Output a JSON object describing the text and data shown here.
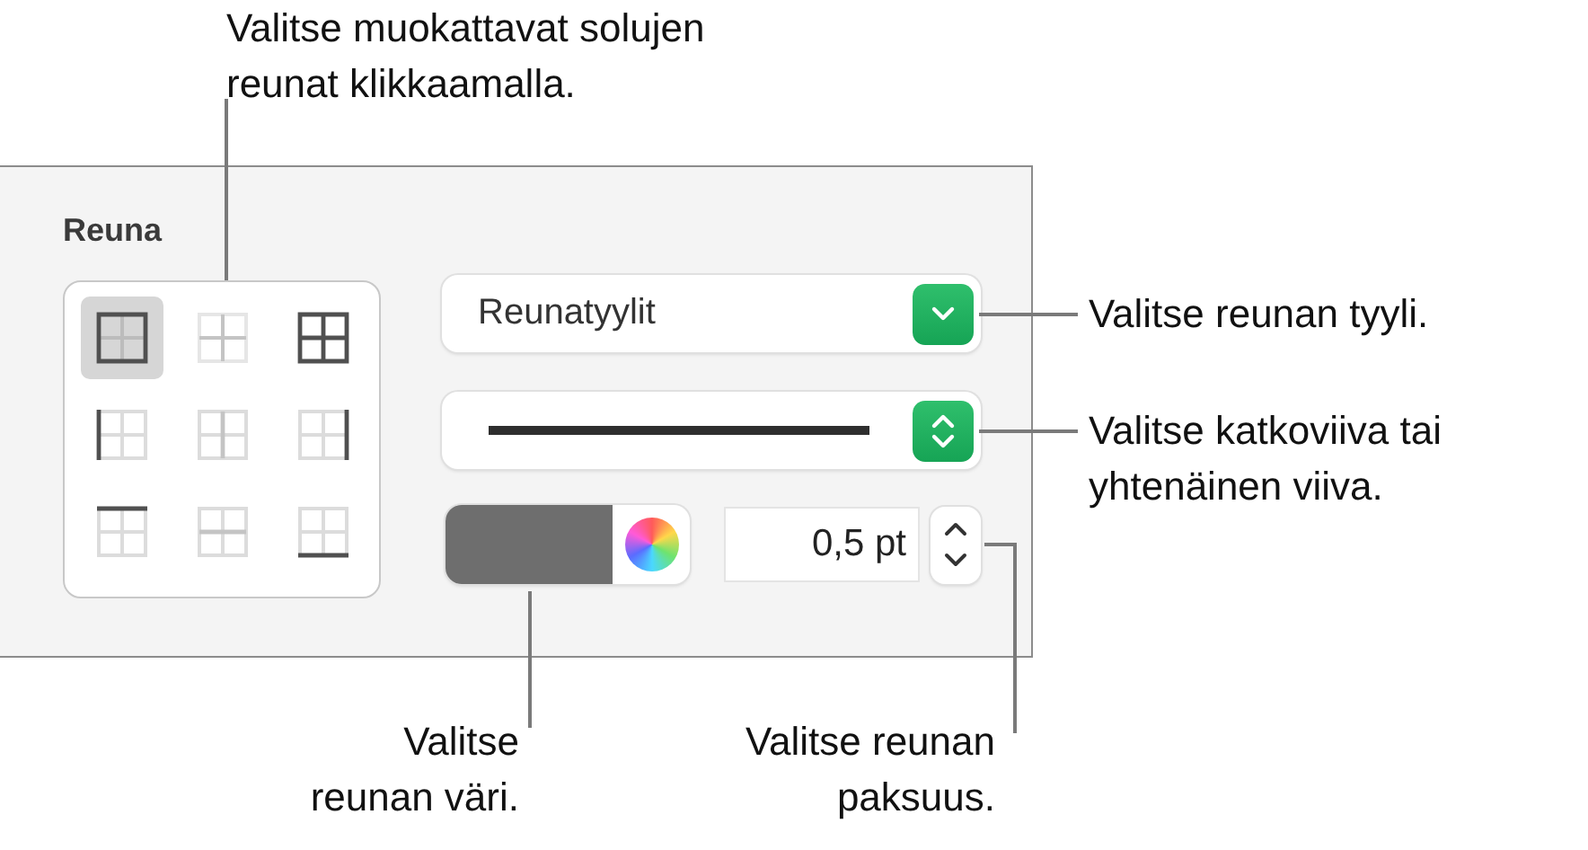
{
  "panel": {
    "title": "Reuna",
    "border_buttons": [
      {
        "kind": "outer",
        "selected": true
      },
      {
        "kind": "inner",
        "selected": false
      },
      {
        "kind": "all",
        "selected": false
      },
      {
        "kind": "left",
        "selected": false
      },
      {
        "kind": "vertical-center",
        "selected": false
      },
      {
        "kind": "right",
        "selected": false
      },
      {
        "kind": "top",
        "selected": false
      },
      {
        "kind": "horizontal-center",
        "selected": false
      },
      {
        "kind": "bottom",
        "selected": false
      }
    ],
    "style_menu": {
      "value": "Reunatyylit"
    },
    "color_well": {
      "color": "#6e6e6e"
    },
    "width_field": {
      "value": "0,5 pt"
    }
  },
  "callouts": [
    {
      "kind": "top",
      "text": "Valitse muokattavat solujen\nreunat klikkaamalla."
    },
    {
      "kind": "style",
      "text": "Valitse reunan tyyli."
    },
    {
      "kind": "line",
      "text": "Valitse katkoviiva tai\nyhtenäinen viiva."
    },
    {
      "kind": "color",
      "text": "Valitse\nreunan väri."
    },
    {
      "kind": "width",
      "text": "Valitse reunan\npaksuus."
    }
  ]
}
